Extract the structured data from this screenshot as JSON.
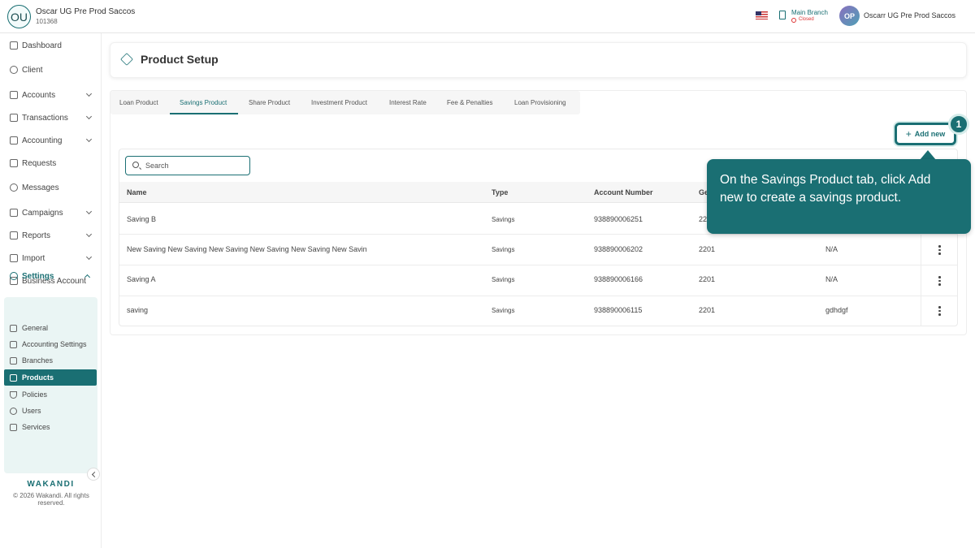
{
  "topbar": {
    "org_initials": "OU",
    "org_name": "Oscar UG Pre Prod Saccos",
    "org_id": "101368",
    "branch_name": "Main Branch",
    "branch_status": "Closed",
    "user_initials": "OP",
    "user_name": "Oscarr UG Pre Prod Saccos"
  },
  "sidebar": {
    "items": [
      {
        "label": "Dashboard",
        "icon": "home-icon",
        "chevron": false
      },
      {
        "label": "Client",
        "icon": "users-icon",
        "chevron": false
      },
      {
        "label": "Accounts",
        "icon": "briefcase-icon",
        "chevron": true
      },
      {
        "label": "Transactions",
        "icon": "money-icon",
        "chevron": true
      },
      {
        "label": "Accounting",
        "icon": "ledger-icon",
        "chevron": true
      },
      {
        "label": "Requests",
        "icon": "mail-icon",
        "chevron": false
      },
      {
        "label": "Messages",
        "icon": "chat-icon",
        "chevron": false
      },
      {
        "label": "Campaigns",
        "icon": "grid-icon",
        "chevron": true
      },
      {
        "label": "Reports",
        "icon": "chart-icon",
        "chevron": true
      },
      {
        "label": "Import",
        "icon": "upload-icon",
        "chevron": true
      },
      {
        "label": "Business Account",
        "icon": "bank-icon",
        "chevron": false
      }
    ],
    "settings_label": "Settings",
    "settings_items": [
      {
        "label": "General",
        "icon": "wrench-icon"
      },
      {
        "label": "Accounting Settings",
        "icon": "calculator-icon"
      },
      {
        "label": "Branches",
        "icon": "building-icon"
      },
      {
        "label": "Products",
        "icon": "tag-icon",
        "active": true
      },
      {
        "label": "Policies",
        "icon": "shield-icon"
      },
      {
        "label": "Users",
        "icon": "user-group-icon"
      },
      {
        "label": "Services",
        "icon": "list-icon"
      }
    ],
    "brand": "WAKANDI",
    "copyright": "© 2026 Wakandi. All rights reserved."
  },
  "main": {
    "page_title": "Product Setup",
    "tabs": [
      {
        "label": "Loan Product",
        "active": false
      },
      {
        "label": "Savings Product",
        "active": true
      },
      {
        "label": "Share Product",
        "active": false
      },
      {
        "label": "Investment Product",
        "active": false
      },
      {
        "label": "Interest Rate",
        "active": false
      },
      {
        "label": "Fee & Penalties",
        "active": false
      },
      {
        "label": "Loan Provisioning",
        "active": false
      }
    ],
    "add_new_label": "Add new",
    "search_placeholder": "Search",
    "columns": [
      "Name",
      "Type",
      "Account Number",
      "Ge"
    ],
    "rows": [
      {
        "name": "Saving B",
        "type": "Savings",
        "account": "938890006251",
        "gl": "22",
        "extra": ""
      },
      {
        "name": "New Saving New Saving New Saving New Saving New Saving New Savin",
        "type": "Savings",
        "account": "938890006202",
        "gl": "2201",
        "extra": "N/A"
      },
      {
        "name": "Saving A",
        "type": "Savings",
        "account": "938890006166",
        "gl": "2201",
        "extra": "N/A"
      },
      {
        "name": "saving",
        "type": "Savings",
        "account": "938890006115",
        "gl": "2201",
        "extra": "gdhdgf"
      }
    ]
  },
  "guide": {
    "step": "1",
    "text": "On the Savings Product tab, click Add new to create a savings product."
  },
  "colors": {
    "accent": "#1a6f73",
    "closed": "#dd3333"
  }
}
